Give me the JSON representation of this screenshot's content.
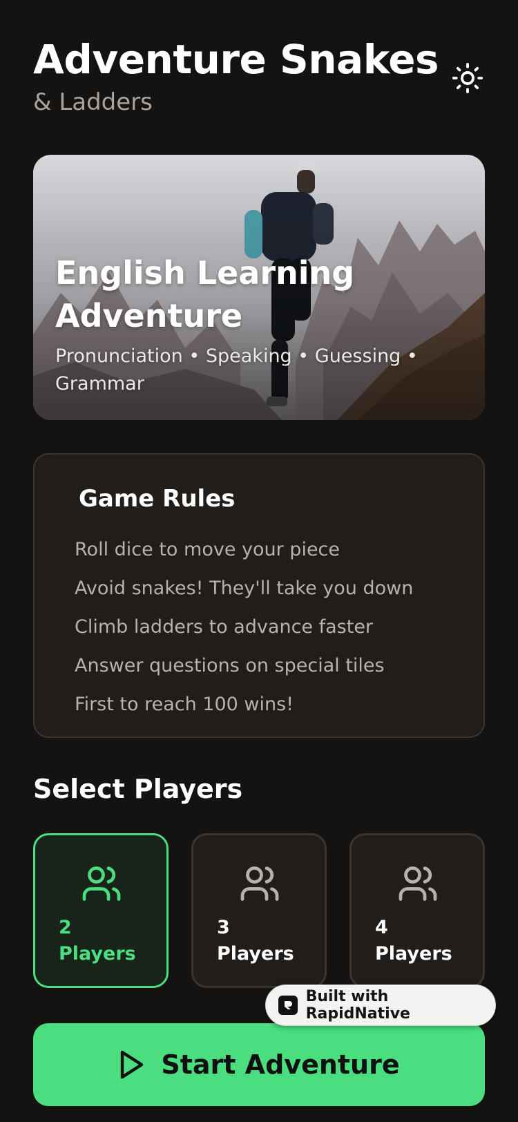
{
  "header": {
    "title": "Adventure Snakes",
    "subtitle": "& Ladders"
  },
  "hero": {
    "title_line1": "English Learning",
    "title_line2": "Adventure",
    "subtitle_line1": "Pronunciation • Speaking • Guessing •",
    "subtitle_line2": "Grammar"
  },
  "rules": {
    "title": "Game Rules",
    "items": [
      "Roll dice to move your piece",
      "Avoid snakes! They'll take you down",
      "Climb ladders to advance faster",
      "Answer questions on special tiles",
      "First to reach 100 wins!"
    ]
  },
  "players": {
    "title": "Select Players",
    "options": [
      {
        "count": "2",
        "label": "Players",
        "selected": true
      },
      {
        "count": "3",
        "label": "Players",
        "selected": false
      },
      {
        "count": "4",
        "label": "Players",
        "selected": false
      }
    ]
  },
  "start_button": {
    "label": "Start Adventure"
  },
  "badge": {
    "label": "Built with RapidNative"
  },
  "colors": {
    "background": "#141312",
    "accent": "#4ade80",
    "card": "#211d1b",
    "muted_text": "#b8b2ac"
  },
  "icons": {
    "theme_toggle": "sun-icon",
    "player": "users-icon",
    "start": "play-icon"
  }
}
